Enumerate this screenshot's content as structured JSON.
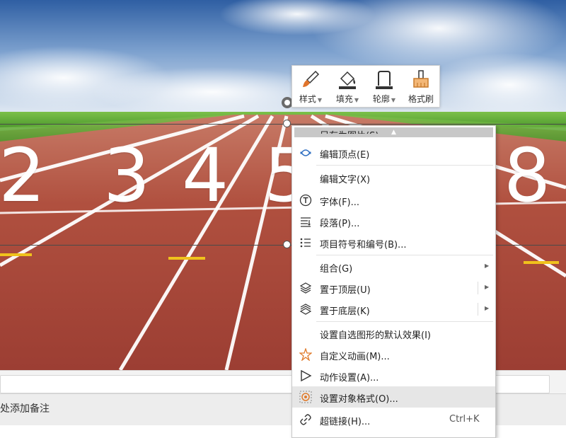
{
  "slide": {
    "lane_numbers": [
      "2",
      "3",
      "4",
      "5",
      "8"
    ]
  },
  "notes": {
    "placeholder": "处添加备注"
  },
  "mini_toolbar": {
    "buttons": [
      {
        "label": "样式",
        "icon": "paintbrush-icon",
        "has_caret": true
      },
      {
        "label": "填充",
        "icon": "paint-bucket-icon",
        "has_caret": true
      },
      {
        "label": "轮廓",
        "icon": "outline-shape-icon",
        "has_caret": true
      },
      {
        "label": "格式刷",
        "icon": "format-painter-icon",
        "has_caret": false
      }
    ]
  },
  "context_menu": {
    "partial_top_label": "另存为图片(S)",
    "items": [
      {
        "label": "编辑顶点(E)",
        "icon": "edit-points-icon"
      },
      {
        "label": "编辑文字(X)",
        "icon": ""
      },
      {
        "label": "字体(F)...",
        "icon": "font-icon"
      },
      {
        "label": "段落(P)...",
        "icon": "paragraph-icon"
      },
      {
        "label": "项目符号和编号(B)...",
        "icon": "bullet-list-icon"
      },
      {
        "label": "组合(G)",
        "icon": "",
        "submenu": true
      },
      {
        "label": "置于顶层(U)",
        "icon": "bring-to-front-icon",
        "submenu": true
      },
      {
        "label": "置于底层(K)",
        "icon": "send-to-back-icon",
        "submenu": true
      },
      {
        "label": "设置自选图形的默认效果(I)",
        "icon": ""
      },
      {
        "label": "自定义动画(M)...",
        "icon": "custom-animation-icon"
      },
      {
        "label": "动作设置(A)...",
        "icon": "action-settings-icon"
      },
      {
        "label": "设置对象格式(O)...",
        "icon": "format-object-icon",
        "hovered": true
      },
      {
        "label": "超链接(H)...",
        "icon": "hyperlink-icon",
        "shortcut": "Ctrl+K"
      }
    ]
  },
  "colors": {
    "track": "#a8453a",
    "grass": "#5aa33a",
    "sky": "#3f74b8",
    "menu_hover": "#e6e6e6"
  }
}
